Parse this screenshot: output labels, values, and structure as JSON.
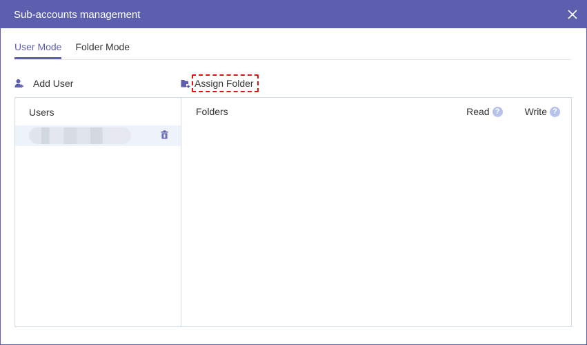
{
  "dialog": {
    "title": "Sub-accounts management"
  },
  "tabs": [
    {
      "label": "User Mode",
      "active": true
    },
    {
      "label": "Folder Mode",
      "active": false
    }
  ],
  "toolbar": {
    "add_user_label": "Add User",
    "assign_folder_label": "Assign Folder"
  },
  "users_panel": {
    "header": "Users"
  },
  "folders_panel": {
    "header_folders": "Folders",
    "header_read": "Read",
    "header_write": "Write",
    "help_glyph": "?"
  },
  "colors": {
    "accent": "#5b5fae",
    "highlight_dash": "#e01010",
    "selected_row": "#eef2fb",
    "help_icon": "#b8c3ec"
  },
  "icons": {
    "close": "close-icon",
    "add_user": "add-user-icon",
    "assign_folder": "add-folder-icon",
    "trash": "trash-icon",
    "help": "help-circle-icon"
  }
}
